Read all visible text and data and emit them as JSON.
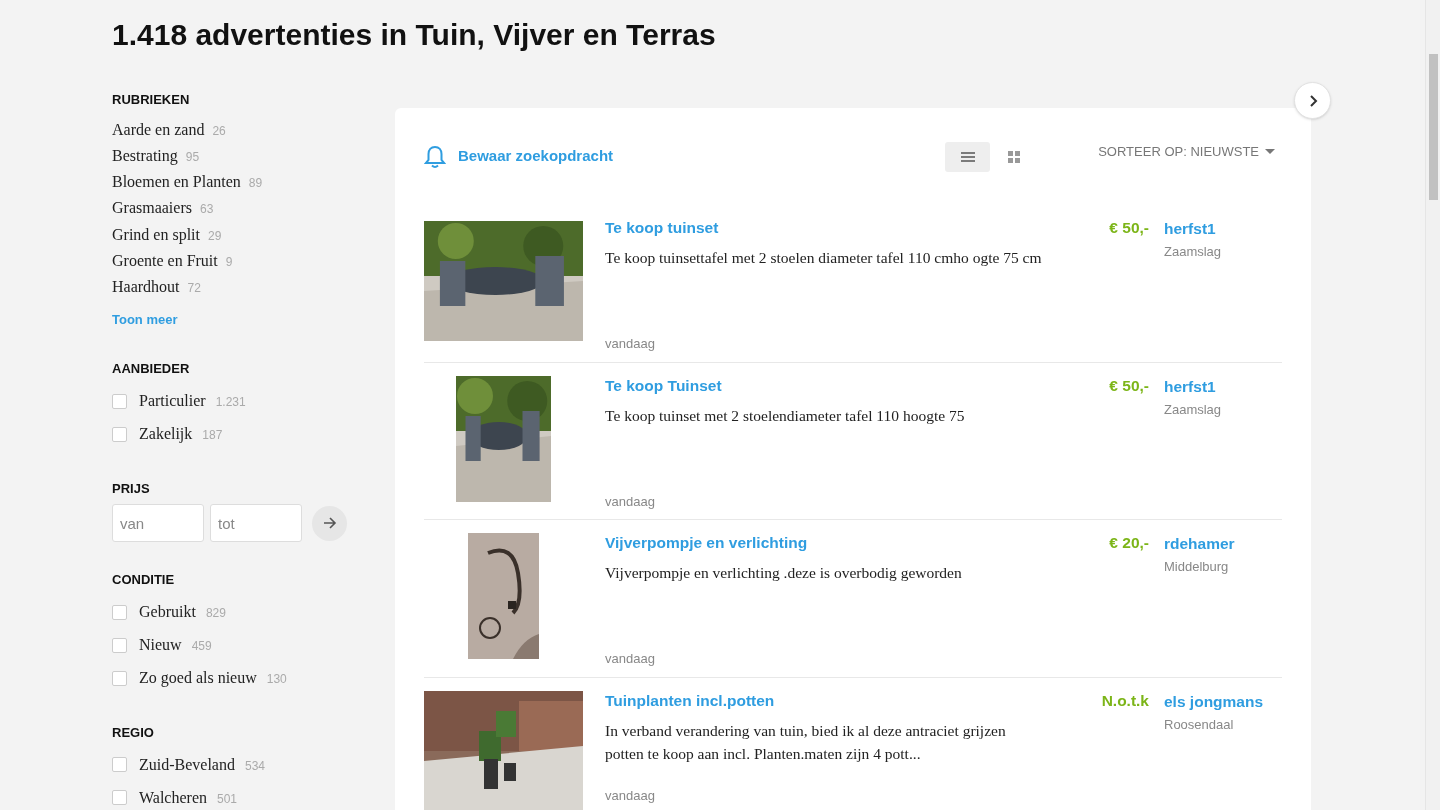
{
  "heading": "1.418 advertenties in Tuin, Vijver en Terras",
  "sidebar": {
    "categories": {
      "title": "RUBRIEKEN",
      "items": [
        {
          "label": "Aarde en zand",
          "count": "26"
        },
        {
          "label": "Bestrating",
          "count": "95"
        },
        {
          "label": "Bloemen en Planten",
          "count": "89"
        },
        {
          "label": "Grasmaaiers",
          "count": "63"
        },
        {
          "label": "Grind en split",
          "count": "29"
        },
        {
          "label": "Groente en Fruit",
          "count": "9"
        },
        {
          "label": "Haardhout",
          "count": "72"
        }
      ],
      "more": "Toon meer"
    },
    "filters": [
      {
        "kind": "checkboxes",
        "title": "AANBIEDER",
        "options": [
          {
            "label": "Particulier",
            "count": "1.231",
            "checked": false
          },
          {
            "label": "Zakelijk",
            "count": "187",
            "checked": false
          }
        ]
      },
      {
        "kind": "price",
        "title": "PRIJS",
        "from_placeholder": "van",
        "to_placeholder": "tot"
      },
      {
        "kind": "checkboxes",
        "title": "CONDITIE",
        "options": [
          {
            "label": "Gebruikt",
            "count": "829",
            "checked": false
          },
          {
            "label": "Nieuw",
            "count": "459",
            "checked": false
          },
          {
            "label": "Zo goed als nieuw",
            "count": "130",
            "checked": false
          }
        ]
      },
      {
        "kind": "checkboxes",
        "title": "REGIO",
        "options": [
          {
            "label": "Zuid-Beveland",
            "count": "534",
            "checked": false
          },
          {
            "label": "Walcheren",
            "count": "501",
            "checked": false
          }
        ]
      }
    ]
  },
  "toolbar": {
    "save_search": "Bewaar zoekopdracht",
    "views": [
      {
        "kind": "list",
        "selected": true
      },
      {
        "kind": "grid",
        "selected": false
      }
    ],
    "sort": "SORTEER OP: NIEUWSTE"
  },
  "listings": [
    {
      "title": "Te koop tuinset",
      "description": "Te koop tuinsettafel met 2 stoelen diameter tafel 110 cmho ogte 75 cm",
      "date": "vandaag",
      "price": "€ 50,-",
      "seller": "herfst1",
      "location": "Zaamslag"
    },
    {
      "title": "Te koop Tuinset",
      "description": "Te koop tuinset met 2 stoelendiameter tafel 110 hoogte 75",
      "date": "vandaag",
      "price": "€ 50,-",
      "seller": "herfst1",
      "location": "Zaamslag"
    },
    {
      "title": "Vijverpompje en verlichting",
      "description": "Vijverpompje en verlichting .deze is overbodig geworden",
      "date": "vandaag",
      "price": "€ 20,-",
      "seller": "rdehamer",
      "location": "Middelburg"
    },
    {
      "title": "Tuinplanten incl.potten",
      "description": "In verband verandering van tuin, bied ik al deze antraciet grijzen potten te koop aan incl. Planten.maten zijn  4 pott...",
      "date": "vandaag",
      "price": "N.o.t.k",
      "seller": "els jongmans",
      "location": "Roosendaal"
    }
  ]
}
